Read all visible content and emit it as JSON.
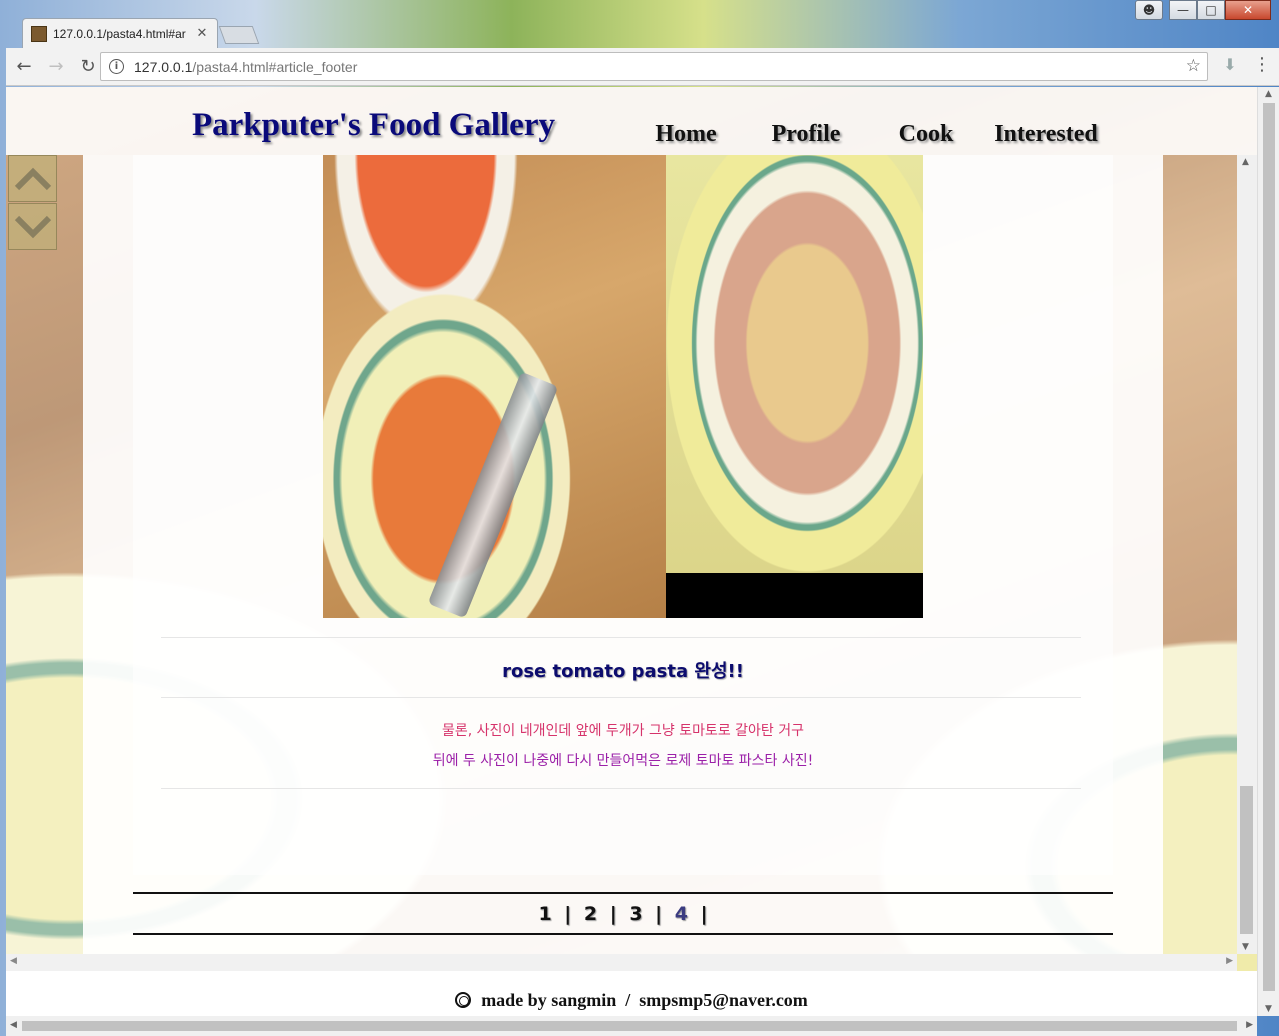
{
  "browser": {
    "tab_title": "127.0.0.1/pasta4.html#ar",
    "url_host": "127.0.0.1",
    "url_path": "/pasta4.html#article_footer",
    "back_icon": "arrow-left-icon",
    "forward_icon": "arrow-right-icon",
    "reload_icon": "reload-icon",
    "bookmark_icon": "star-icon",
    "menu_icon": "kebab-menu-icon"
  },
  "site": {
    "title": "Parkputer's Food Gallery",
    "nav": [
      "Home",
      "Profile",
      "Cook",
      "Interested"
    ]
  },
  "article": {
    "caption": "rose tomato pasta 완성!!",
    "desc_line1": "물론, 사진이 네개인데 앞에 두개가 그냥 토마토로 갈아탄 거구",
    "desc_line2": "뒤에 두 사진이 나중에 다시 만들어먹은 로제 토마토 파스타 사진!",
    "desc_colors": [
      "#d6336b",
      "#9b1fa8"
    ]
  },
  "pager": {
    "pages": [
      "1",
      "2",
      "3",
      "4"
    ],
    "separator": "|",
    "current": "4"
  },
  "footer": {
    "text": "made by sangmin  /  smpsmp5@naver.com"
  },
  "colors": {
    "title": "#0a0a7a",
    "caption": "#0c0c6e"
  }
}
